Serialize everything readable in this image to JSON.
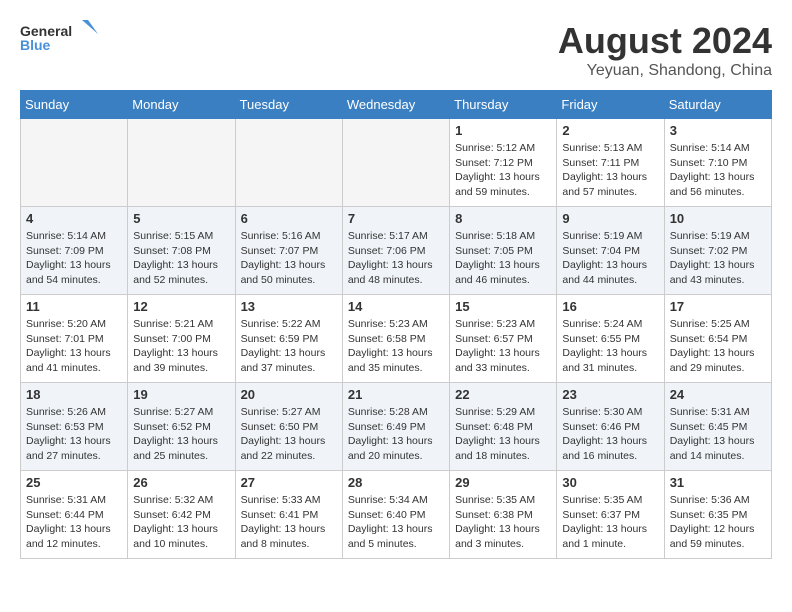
{
  "header": {
    "logo_line1": "General",
    "logo_line2": "Blue",
    "month_year": "August 2024",
    "location": "Yeyuan, Shandong, China"
  },
  "weekdays": [
    "Sunday",
    "Monday",
    "Tuesday",
    "Wednesday",
    "Thursday",
    "Friday",
    "Saturday"
  ],
  "weeks": [
    [
      {
        "day": "",
        "info": ""
      },
      {
        "day": "",
        "info": ""
      },
      {
        "day": "",
        "info": ""
      },
      {
        "day": "",
        "info": ""
      },
      {
        "day": "1",
        "info": "Sunrise: 5:12 AM\nSunset: 7:12 PM\nDaylight: 13 hours\nand 59 minutes."
      },
      {
        "day": "2",
        "info": "Sunrise: 5:13 AM\nSunset: 7:11 PM\nDaylight: 13 hours\nand 57 minutes."
      },
      {
        "day": "3",
        "info": "Sunrise: 5:14 AM\nSunset: 7:10 PM\nDaylight: 13 hours\nand 56 minutes."
      }
    ],
    [
      {
        "day": "4",
        "info": "Sunrise: 5:14 AM\nSunset: 7:09 PM\nDaylight: 13 hours\nand 54 minutes."
      },
      {
        "day": "5",
        "info": "Sunrise: 5:15 AM\nSunset: 7:08 PM\nDaylight: 13 hours\nand 52 minutes."
      },
      {
        "day": "6",
        "info": "Sunrise: 5:16 AM\nSunset: 7:07 PM\nDaylight: 13 hours\nand 50 minutes."
      },
      {
        "day": "7",
        "info": "Sunrise: 5:17 AM\nSunset: 7:06 PM\nDaylight: 13 hours\nand 48 minutes."
      },
      {
        "day": "8",
        "info": "Sunrise: 5:18 AM\nSunset: 7:05 PM\nDaylight: 13 hours\nand 46 minutes."
      },
      {
        "day": "9",
        "info": "Sunrise: 5:19 AM\nSunset: 7:04 PM\nDaylight: 13 hours\nand 44 minutes."
      },
      {
        "day": "10",
        "info": "Sunrise: 5:19 AM\nSunset: 7:02 PM\nDaylight: 13 hours\nand 43 minutes."
      }
    ],
    [
      {
        "day": "11",
        "info": "Sunrise: 5:20 AM\nSunset: 7:01 PM\nDaylight: 13 hours\nand 41 minutes."
      },
      {
        "day": "12",
        "info": "Sunrise: 5:21 AM\nSunset: 7:00 PM\nDaylight: 13 hours\nand 39 minutes."
      },
      {
        "day": "13",
        "info": "Sunrise: 5:22 AM\nSunset: 6:59 PM\nDaylight: 13 hours\nand 37 minutes."
      },
      {
        "day": "14",
        "info": "Sunrise: 5:23 AM\nSunset: 6:58 PM\nDaylight: 13 hours\nand 35 minutes."
      },
      {
        "day": "15",
        "info": "Sunrise: 5:23 AM\nSunset: 6:57 PM\nDaylight: 13 hours\nand 33 minutes."
      },
      {
        "day": "16",
        "info": "Sunrise: 5:24 AM\nSunset: 6:55 PM\nDaylight: 13 hours\nand 31 minutes."
      },
      {
        "day": "17",
        "info": "Sunrise: 5:25 AM\nSunset: 6:54 PM\nDaylight: 13 hours\nand 29 minutes."
      }
    ],
    [
      {
        "day": "18",
        "info": "Sunrise: 5:26 AM\nSunset: 6:53 PM\nDaylight: 13 hours\nand 27 minutes."
      },
      {
        "day": "19",
        "info": "Sunrise: 5:27 AM\nSunset: 6:52 PM\nDaylight: 13 hours\nand 25 minutes."
      },
      {
        "day": "20",
        "info": "Sunrise: 5:27 AM\nSunset: 6:50 PM\nDaylight: 13 hours\nand 22 minutes."
      },
      {
        "day": "21",
        "info": "Sunrise: 5:28 AM\nSunset: 6:49 PM\nDaylight: 13 hours\nand 20 minutes."
      },
      {
        "day": "22",
        "info": "Sunrise: 5:29 AM\nSunset: 6:48 PM\nDaylight: 13 hours\nand 18 minutes."
      },
      {
        "day": "23",
        "info": "Sunrise: 5:30 AM\nSunset: 6:46 PM\nDaylight: 13 hours\nand 16 minutes."
      },
      {
        "day": "24",
        "info": "Sunrise: 5:31 AM\nSunset: 6:45 PM\nDaylight: 13 hours\nand 14 minutes."
      }
    ],
    [
      {
        "day": "25",
        "info": "Sunrise: 5:31 AM\nSunset: 6:44 PM\nDaylight: 13 hours\nand 12 minutes."
      },
      {
        "day": "26",
        "info": "Sunrise: 5:32 AM\nSunset: 6:42 PM\nDaylight: 13 hours\nand 10 minutes."
      },
      {
        "day": "27",
        "info": "Sunrise: 5:33 AM\nSunset: 6:41 PM\nDaylight: 13 hours\nand 8 minutes."
      },
      {
        "day": "28",
        "info": "Sunrise: 5:34 AM\nSunset: 6:40 PM\nDaylight: 13 hours\nand 5 minutes."
      },
      {
        "day": "29",
        "info": "Sunrise: 5:35 AM\nSunset: 6:38 PM\nDaylight: 13 hours\nand 3 minutes."
      },
      {
        "day": "30",
        "info": "Sunrise: 5:35 AM\nSunset: 6:37 PM\nDaylight: 13 hours\nand 1 minute."
      },
      {
        "day": "31",
        "info": "Sunrise: 5:36 AM\nSunset: 6:35 PM\nDaylight: 12 hours\nand 59 minutes."
      }
    ]
  ]
}
